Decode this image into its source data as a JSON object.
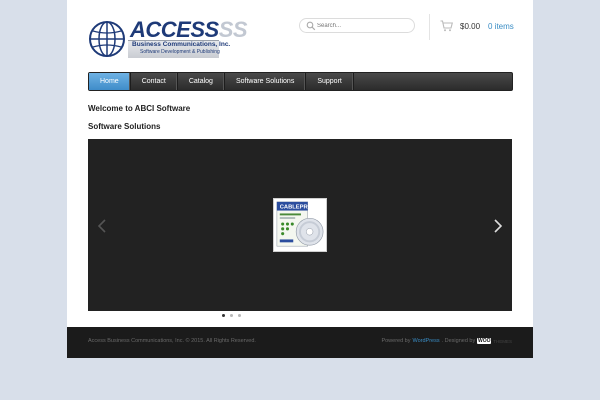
{
  "header": {
    "logo": {
      "word_main": "ACCESS",
      "word_suffix": "SS",
      "line1": "Business Communications, Inc.",
      "line2": "Software Development & Publishing"
    },
    "search": {
      "placeholder": "Search..."
    },
    "cart": {
      "total": "$0.00",
      "items": "0 items"
    }
  },
  "nav": {
    "items": [
      {
        "label": "Home",
        "active": true
      },
      {
        "label": "Contact"
      },
      {
        "label": "Catalog"
      },
      {
        "label": "Software Solutions"
      },
      {
        "label": "Support"
      }
    ]
  },
  "content": {
    "welcome": "Welcome to ABCI Software",
    "section_title": "Software Solutions",
    "slide": {
      "product_name": "CABLEPRO"
    },
    "slider_dots": {
      "count": 3,
      "active_index": 0
    }
  },
  "footer": {
    "copyright": "Access Business Communications, Inc. © 2015. All Rights Reserved.",
    "powered_by": "Powered by",
    "wordpress": "WordPress",
    "designed_by": ". Designed by",
    "woo": "WOO",
    "woo_suffix": "THEMES"
  },
  "colors": {
    "background": "#d8dfea",
    "accent": "#3a8dc5",
    "nav_active": "#4f9bd4",
    "slider_bg": "#222222",
    "footer_bg": "#1b1b1b"
  }
}
